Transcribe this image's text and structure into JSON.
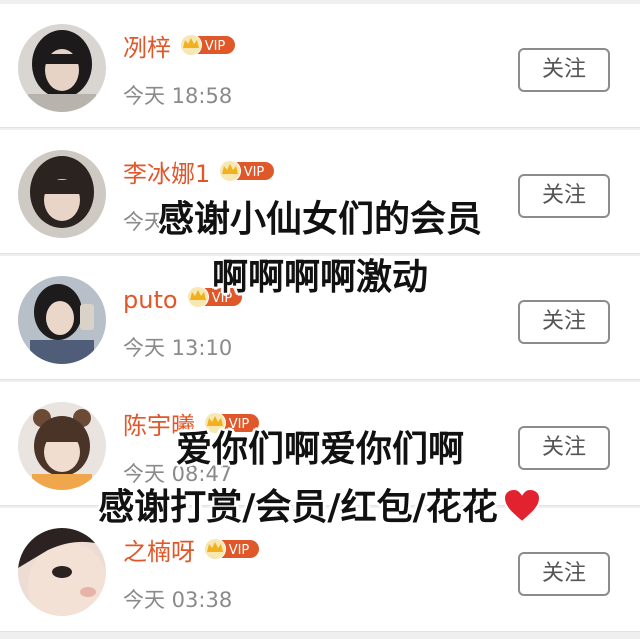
{
  "colors": {
    "name": "#e0572a",
    "time": "#8a8a8a",
    "vip_badge": "#e0572a",
    "crown": "#f2b01e",
    "heart": "#e2222e"
  },
  "follow_label": "关注",
  "vip_label": "VIP",
  "users": [
    {
      "name": "冽梓",
      "time": "今天 18:58"
    },
    {
      "name": "李冰娜1",
      "time": "今天"
    },
    {
      "name": "puto",
      "time": "今天 13:10"
    },
    {
      "name": "陈宇曦",
      "time": "今天 08:47"
    },
    {
      "name": "之楠呀",
      "time": "今天 03:38"
    }
  ],
  "overlay": {
    "line1": "感谢小仙女们的会员",
    "line2": "啊啊啊啊激动",
    "line3": "爱你们啊爱你们啊",
    "line4": "感谢打赏/会员/红包/花花"
  }
}
